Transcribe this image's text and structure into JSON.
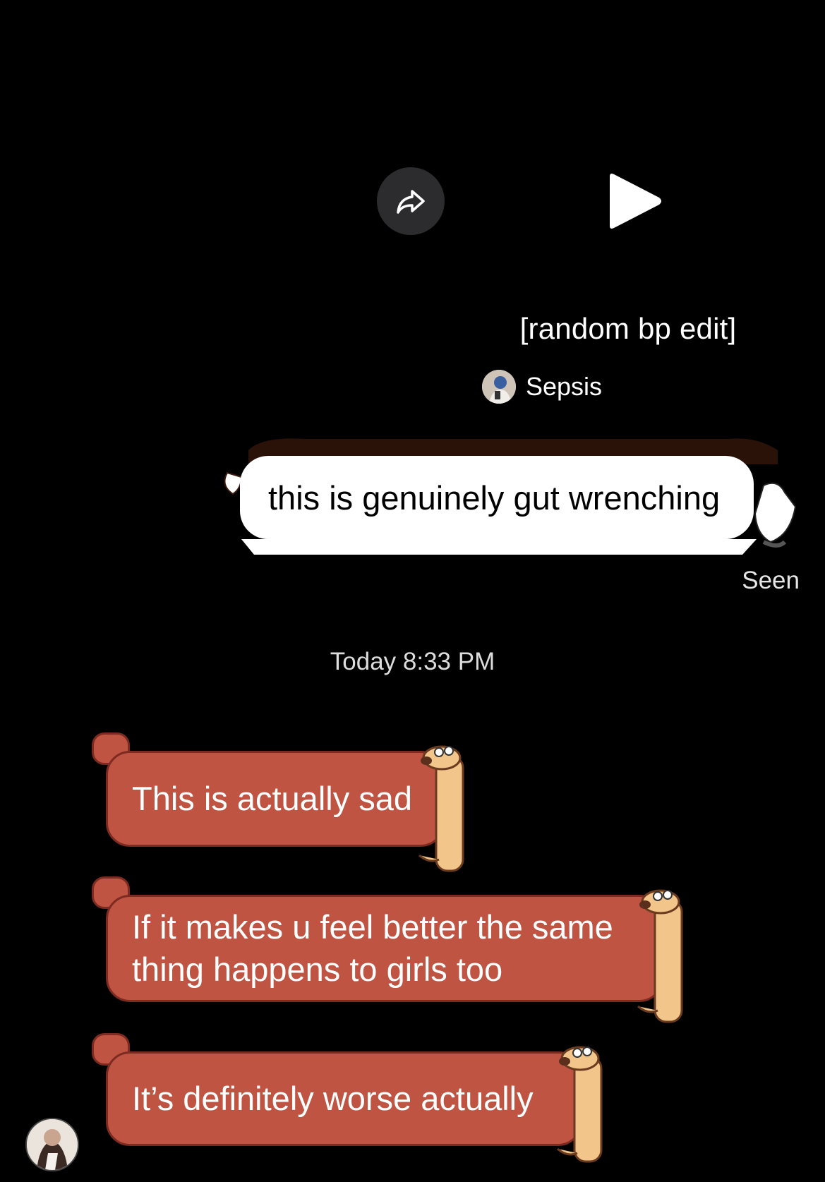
{
  "shared_video": {
    "title": "[random bp edit]",
    "author": "Sepsis",
    "share_icon": "share-arrow-icon",
    "play_icon": "play-icon"
  },
  "outgoing": [
    {
      "text": "this is genuinely gut wrenching",
      "status": "Seen"
    }
  ],
  "timestamp": "Today 8:33 PM",
  "incoming": [
    {
      "text": "This is actually sad"
    },
    {
      "text": "If it makes u feel better the same thing happens to girls too"
    },
    {
      "text": "It’s definitely worse actually"
    }
  ],
  "colors": {
    "background": "#000000",
    "incoming_bubble": "#bf5443",
    "outgoing_bubble": "#ffffff"
  }
}
